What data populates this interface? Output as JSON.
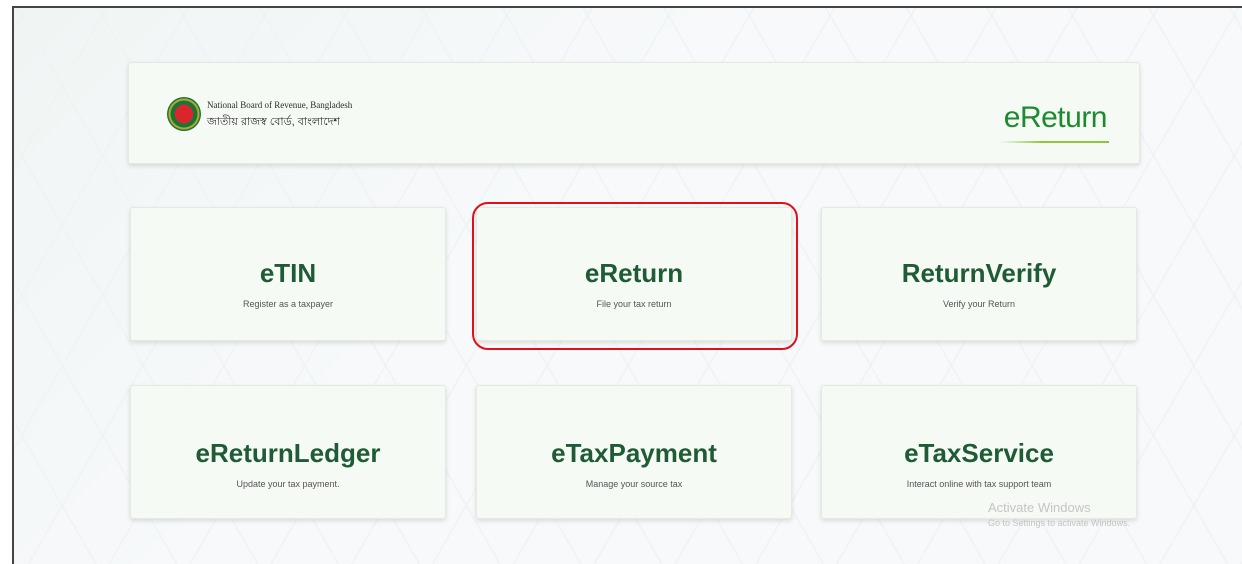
{
  "header": {
    "org_name_en": "National Board of Revenue, Bangladesh",
    "org_name_bn": "জাতীয় রাজস্ব বোর্ড, বাংলাদেশ",
    "brand": "eReturn"
  },
  "services": [
    {
      "title": "eTIN",
      "subtitle": "Register as a taxpayer"
    },
    {
      "title": "eReturn",
      "subtitle": "File your tax return"
    },
    {
      "title": "ReturnVerify",
      "subtitle": "Verify your Return"
    },
    {
      "title": "eReturnLedger",
      "subtitle": "Update your tax payment."
    },
    {
      "title": "eTaxPayment",
      "subtitle": "Manage your source tax"
    },
    {
      "title": "eTaxService",
      "subtitle": "Interact online with tax support team"
    }
  ],
  "watermark": {
    "title": "Activate Windows",
    "subtitle": "Go to Settings to activate Windows."
  },
  "colors": {
    "title_green": "#1f5c35",
    "brand_green": "#1c8a2e",
    "highlight_red": "#e0101a",
    "card_bg": "#f6faf5"
  }
}
